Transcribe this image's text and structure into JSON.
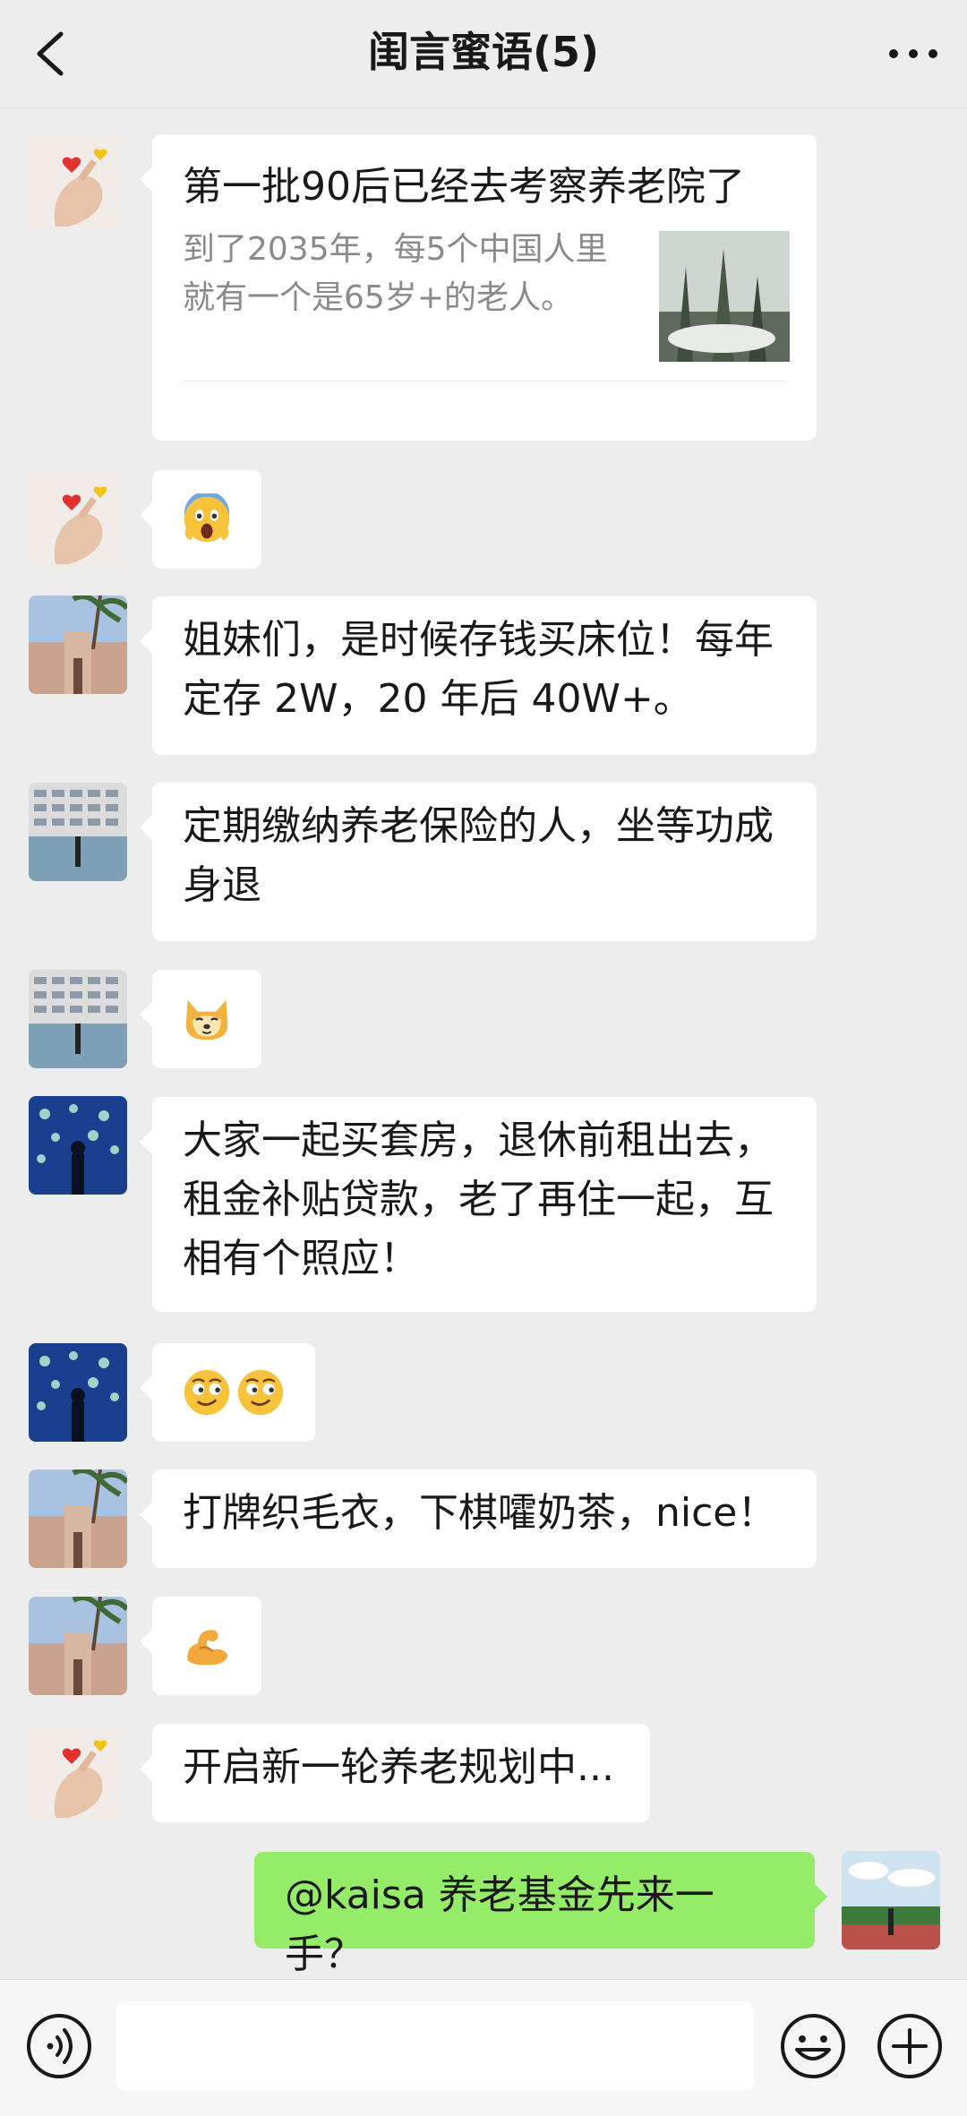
{
  "header": {
    "title": "闺言蜜语(5)",
    "back_icon": "chevron-left-icon",
    "more_icon": "more-dots-icon"
  },
  "messages": [
    {
      "link_title": "第一批90后已经去考察养老院了",
      "link_desc": "到了2035年，每5个中国人里就有一个是65岁+的老人。"
    },
    {
      "emoji": "scream-emoji"
    },
    {
      "text": "姐妹们，是时候存钱买床位！每年定存 2W，20 年后 40W+。"
    },
    {
      "text": "定期缴纳养老保险的人，坐等功成身退"
    },
    {
      "emoji": "doge-emoji"
    },
    {
      "text": "大家一起买套房，退休前租出去，租金补贴贷款，老了再住一起，互相有个照应！"
    },
    {
      "emoji": "smirk-emoji"
    },
    {
      "text": "打牌织毛衣，下棋嚯奶茶，nice！"
    },
    {
      "emoji": "flex-emoji"
    },
    {
      "text": "开启新一轮养老规划中..."
    },
    {
      "text": "@kaisa  养老基金先来一手？"
    }
  ],
  "colors": {
    "background": "#ededed",
    "bubble": "#ffffff",
    "my_bubble": "#95ec69",
    "secondary_text": "#8a8a8a"
  },
  "input_bar": {
    "voice_icon": "voice-icon",
    "emoji_icon": "emoji-face-icon",
    "plus_icon": "plus-icon"
  }
}
